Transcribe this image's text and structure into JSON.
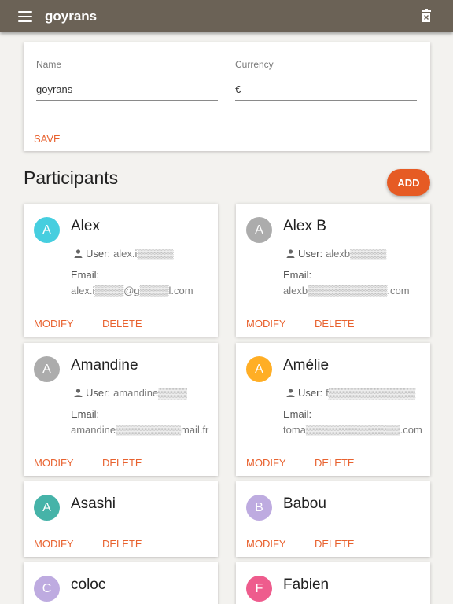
{
  "appbar": {
    "title": "goyrans"
  },
  "settings": {
    "name_label": "Name",
    "name_value": "goyrans",
    "currency_label": "Currency",
    "currency_value": "€",
    "save_label": "SAVE"
  },
  "participants_title": "Participants",
  "add_label": "ADD",
  "labels": {
    "user": "User:",
    "email": "Email:",
    "modify": "MODIFY",
    "delete": "DELETE"
  },
  "participants": [
    {
      "initial": "A",
      "name": "Alex",
      "color": "#26c6da",
      "user": "alex.i▒▒▒▒▒",
      "email": "alex.i▒▒▒▒@g▒▒▒▒l.com"
    },
    {
      "initial": "A",
      "name": "Alex B",
      "color": "#9e9e9e",
      "user": "alexb▒▒▒▒▒",
      "email": "alexb▒▒▒▒▒▒▒▒▒▒▒.com"
    },
    {
      "initial": "A",
      "name": "Amandine",
      "color": "#9e9e9e",
      "user": "amandine▒▒▒▒",
      "email": "amandine▒▒▒▒▒▒▒▒▒mail.fr"
    },
    {
      "initial": "A",
      "name": "Amélie",
      "color": "#ffa000",
      "user": "f▒▒▒▒▒▒▒▒▒▒▒▒",
      "email": "toma▒▒▒▒▒▒▒▒▒▒▒▒▒.com"
    },
    {
      "initial": "A",
      "name": "Asashi",
      "color": "#26a69a"
    },
    {
      "initial": "B",
      "name": "Babou",
      "color": "#b39ddb"
    },
    {
      "initial": "C",
      "name": "coloc",
      "color": "#b39ddb"
    },
    {
      "initial": "F",
      "name": "Fabien",
      "color": "#ec407a"
    }
  ]
}
